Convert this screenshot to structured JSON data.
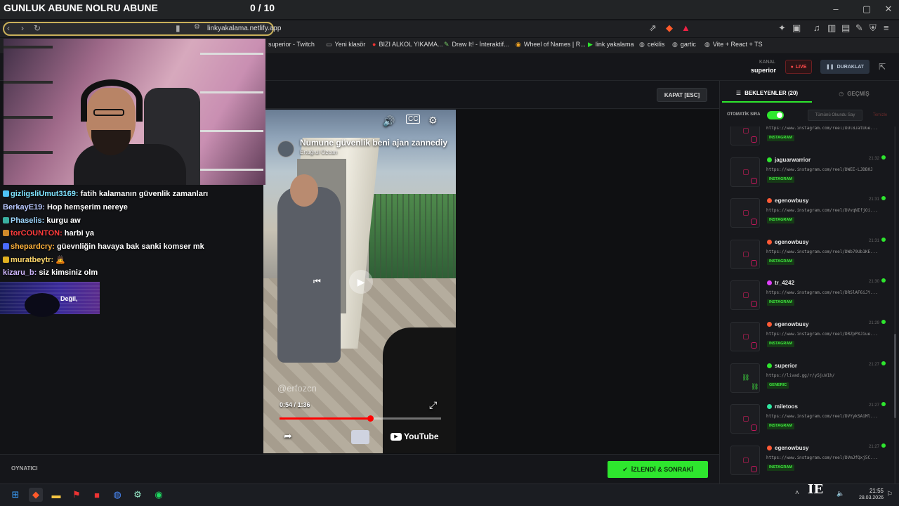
{
  "overlay": {
    "title": "GUNLUK ABUNE NOLRU ABUNE",
    "counter": "0 / 10"
  },
  "browser": {
    "url": "linkyakalama.netlify.app",
    "bookmarks": [
      {
        "label": "superior - Twitch",
        "icon": "twitch-icon"
      },
      {
        "label": "Yeni klasör",
        "icon": "folder-icon"
      },
      {
        "label": "BIZI ALKOL YIKAMA...",
        "icon": "youtube-icon"
      },
      {
        "label": "Draw It! - İnteraktif...",
        "icon": "pencil-icon"
      },
      {
        "label": "Wheel of Names | R...",
        "icon": "wheel-icon"
      },
      {
        "label": "link yakalama",
        "icon": "play-icon"
      },
      {
        "label": "cekilis",
        "icon": "globe-icon"
      },
      {
        "label": "gartic",
        "icon": "globe-icon"
      },
      {
        "label": "Vite + React + TS",
        "icon": "globe-icon"
      }
    ]
  },
  "app": {
    "channel_label": "KANAL",
    "channel_name": "superior",
    "live_label": "LIVE",
    "pause_label": "DURAKLAT",
    "close_label": "KAPAT [ESC]",
    "player_label": "OYNATICI",
    "next_label": "İZLENDİ & SONRAKİ"
  },
  "video": {
    "title": "Numune güvenlik beni ajan zannediy",
    "channel": "Ertuğrul Ozcan",
    "watermark": "@erfozcn",
    "current_time": "0:54",
    "duration": "1:36",
    "progress": 0.5625,
    "brand": "YouTube"
  },
  "chat": {
    "lines": [
      {
        "user": "gizligsliUmut3169:",
        "text": " fatih kalamanın güvenlik zamanları",
        "color": "#7fe3ff",
        "badge": "#4fc3f7"
      },
      {
        "user": "BerkayE19:",
        "text": " Hop hemşerim nereye",
        "color": "#b9c8ff",
        "badge": ""
      },
      {
        "user": "Phaselis:",
        "text": " kurgu aw",
        "color": "#9fd8ff",
        "badge": "#3ab0a0"
      },
      {
        "user": "torCOUNTON:",
        "text": " harbi ya",
        "color": "#ff3b3b",
        "badge": "#d08a2a"
      },
      {
        "user": "shepardcry:",
        "text": " güevnliğin havaya bak sanki komser mk",
        "color": "#ffb13b",
        "badge": "#4a6cff"
      },
      {
        "user": "muratbeytr:",
        "text": " 🙇",
        "color": "#ffd86b",
        "badge": "#e0b020"
      },
      {
        "user": "kizaru_b:",
        "text": " siz kimsiniz olm",
        "color": "#d0b8ff",
        "badge": ""
      }
    ],
    "ad_text": "Değil,"
  },
  "sidebar": {
    "tab_queue": "BEKLEYENLER (20)",
    "tab_history": "GEÇMİŞ",
    "auto_label": "OTOMATİK SIRA",
    "mark_read": "Tümünü Okundu Say",
    "clear": "Temizle",
    "queue": [
      {
        "user": "",
        "time": "",
        "url": "https://www.instagram.com/reel/DUl8JatUGe...",
        "tag": "INSTAGRAM",
        "source": "instagram",
        "color": "#888"
      },
      {
        "user": "jaguarwarrior",
        "time": "21:32",
        "url": "https://www.instagram.com/reel/DWEE-LJDB0J",
        "tag": "INSTAGRAM",
        "source": "instagram",
        "color": "#2ee62e"
      },
      {
        "user": "egenowbusy",
        "time": "21:31",
        "url": "https://www.instagram.com/reel/DVvqNIfjOi...",
        "tag": "INSTAGRAM",
        "source": "instagram",
        "color": "#ff5a36"
      },
      {
        "user": "egenowbusy",
        "time": "21:31",
        "url": "https://www.instagram.com/reel/DWb79Ub1KE...",
        "tag": "INSTAGRAM",
        "source": "instagram",
        "color": "#ff5a36"
      },
      {
        "user": "tr_4242",
        "time": "21:30",
        "url": "https://www.instagram.com/reel/DRSlAF6iJY...",
        "tag": "INSTAGRAM",
        "source": "instagram",
        "color": "#e040fb"
      },
      {
        "user": "egenowbusy",
        "time": "21:29",
        "url": "https://www.instagram.com/reel/DRZpPXJiue...",
        "tag": "INSTAGRAM",
        "source": "instagram",
        "color": "#ff5a36"
      },
      {
        "user": "superior",
        "time": "21:27",
        "url": "https://livad.gg/r/ySjuV1h/",
        "tag": "GENERIC",
        "source": "link",
        "color": "#2ee62e"
      },
      {
        "user": "miletoos",
        "time": "21:27",
        "url": "https://www.instagram.com/reel/DVYykSAiMl...",
        "tag": "INSTAGRAM",
        "source": "instagram",
        "color": "#2ee6a0"
      },
      {
        "user": "egenowbusy",
        "time": "21:27",
        "url": "https://www.instagram.com/reel/DVmJfQxj5C...",
        "tag": "INSTAGRAM",
        "source": "instagram",
        "color": "#ff5a36"
      }
    ]
  },
  "taskbar": {
    "time": "21:55",
    "date": "28.03.2026"
  },
  "colors": {
    "accent": "#2ee62e",
    "live": "#ff4a4a",
    "background": "#121316"
  }
}
